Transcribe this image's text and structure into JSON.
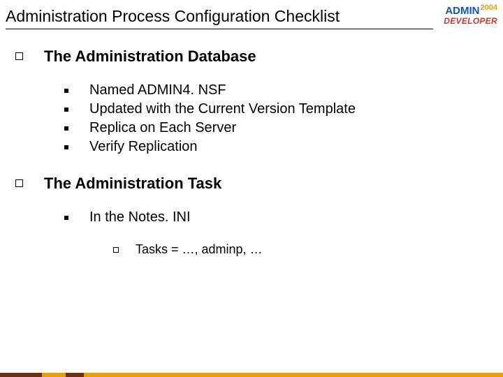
{
  "title": "Administration Process Configuration Checklist",
  "logo": {
    "admin": "ADMIN",
    "year": "2004",
    "developer": "DEVELOPER"
  },
  "sections": [
    {
      "heading": "The Administration Database",
      "items": [
        "Named ADMIN4. NSF",
        "Updated with the Current Version Template",
        "Replica on Each Server",
        "Verify Replication"
      ]
    },
    {
      "heading": "The Administration Task",
      "items": [
        "In the Notes. INI"
      ],
      "subitems": [
        "Tasks = …, adminp, …"
      ]
    }
  ]
}
